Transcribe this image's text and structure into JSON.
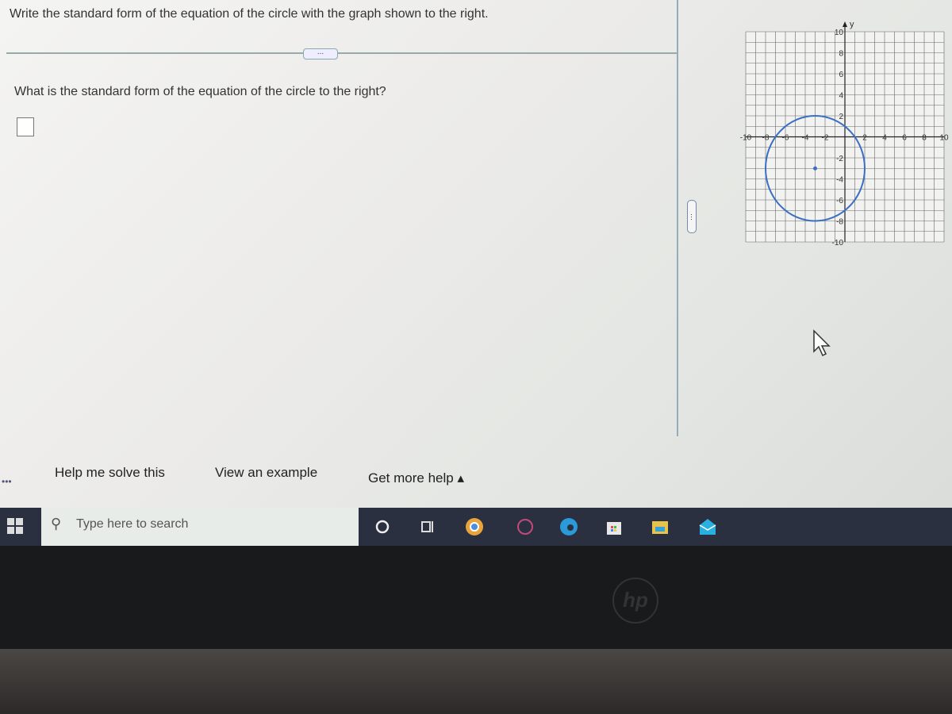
{
  "problem": {
    "prompt": "Write the standard form of the equation of the circle with the graph shown to the right.",
    "more_label": "...",
    "question": "What is the standard form of the equation of the circle to the right?",
    "answer_value": ""
  },
  "graph": {
    "type": "circle-plot",
    "axis_label_y": "y",
    "xlim": [
      -10,
      10
    ],
    "ylim": [
      -10,
      10
    ],
    "grid": true,
    "grid_step": 1,
    "x_ticks": [
      "-10",
      "-8",
      "-6",
      "-4",
      "-2",
      "2",
      "4",
      "6",
      "8",
      "10"
    ],
    "y_ticks": [
      "10",
      "8",
      "6",
      "4",
      "2",
      "-2",
      "-4",
      "-6",
      "-8",
      "-10"
    ],
    "circle": {
      "center": [
        -3,
        -3
      ],
      "radius": 5
    },
    "color": "#3a6fc4"
  },
  "help": {
    "solve": "Help me solve this",
    "example": "View an example",
    "more": "Get more help ▴"
  },
  "taskbar": {
    "search_placeholder": "Type here to search",
    "icons": [
      "cortana-icon",
      "task-view-icon",
      "chrome-icon",
      "app-icon",
      "edge-icon",
      "store-icon",
      "file-explorer-icon",
      "mail-icon"
    ]
  },
  "device": {
    "logo": "hp"
  }
}
